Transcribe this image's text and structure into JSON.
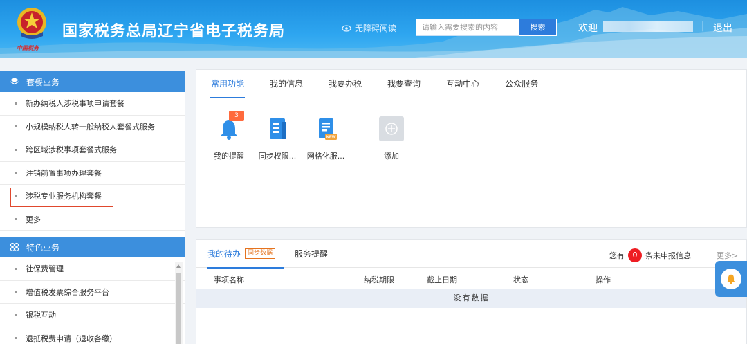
{
  "header": {
    "emblem_text": "中国税务",
    "site_title": "国家税务总局辽宁省电子税务局",
    "accessibility_label": "无障碍阅读",
    "search": {
      "placeholder": "请输入需要搜索的内容",
      "button_label": "搜索"
    },
    "welcome": "欢迎",
    "separator": "|",
    "logout": "退出"
  },
  "sidebar": {
    "package_section": {
      "title": "套餐业务",
      "items": [
        "新办纳税人涉税事项申请套餐",
        "小规模纳税人转一般纳税人套餐式服务",
        "跨区域涉税事项套餐式服务",
        "注销前置事项办理套餐",
        "涉税专业服务机构套餐",
        "更多"
      ]
    },
    "feature_section": {
      "title": "特色业务",
      "items": [
        "社保费管理",
        "增值税发票综合服务平台",
        "银税互动",
        "退抵税费申请（退收各缴）"
      ]
    }
  },
  "main": {
    "tabs": [
      "常用功能",
      "我的信息",
      "我要办税",
      "我要查询",
      "互动中心",
      "公众服务"
    ],
    "shortcuts": [
      {
        "label": "我的提醒",
        "icon": "bell-icon",
        "badge": "3"
      },
      {
        "label": "同步权限...",
        "icon": "document-icon"
      },
      {
        "label": "网格化服...",
        "icon": "new-document-icon",
        "badge_text": "NEW"
      },
      {
        "label": "添加",
        "icon": "plus-icon"
      }
    ]
  },
  "todo": {
    "tab_todo": "我的待办",
    "sync_tag": "同步数据",
    "tab_remind": "服务提醒",
    "unreported_prefix": "您有",
    "unreported_count": "0",
    "unreported_suffix": "条未申报信息",
    "more": "更多>",
    "columns": [
      "事项名称",
      "纳税期限",
      "截止日期",
      "状态",
      "操作"
    ],
    "empty_text": "没有数据"
  },
  "colors": {
    "header_blue": "#2ea6f0",
    "accent_blue": "#2d7cdc",
    "section_blue": "#3c8fdd",
    "highlight_red": "#e0482d",
    "count_red": "#ee1d23"
  }
}
